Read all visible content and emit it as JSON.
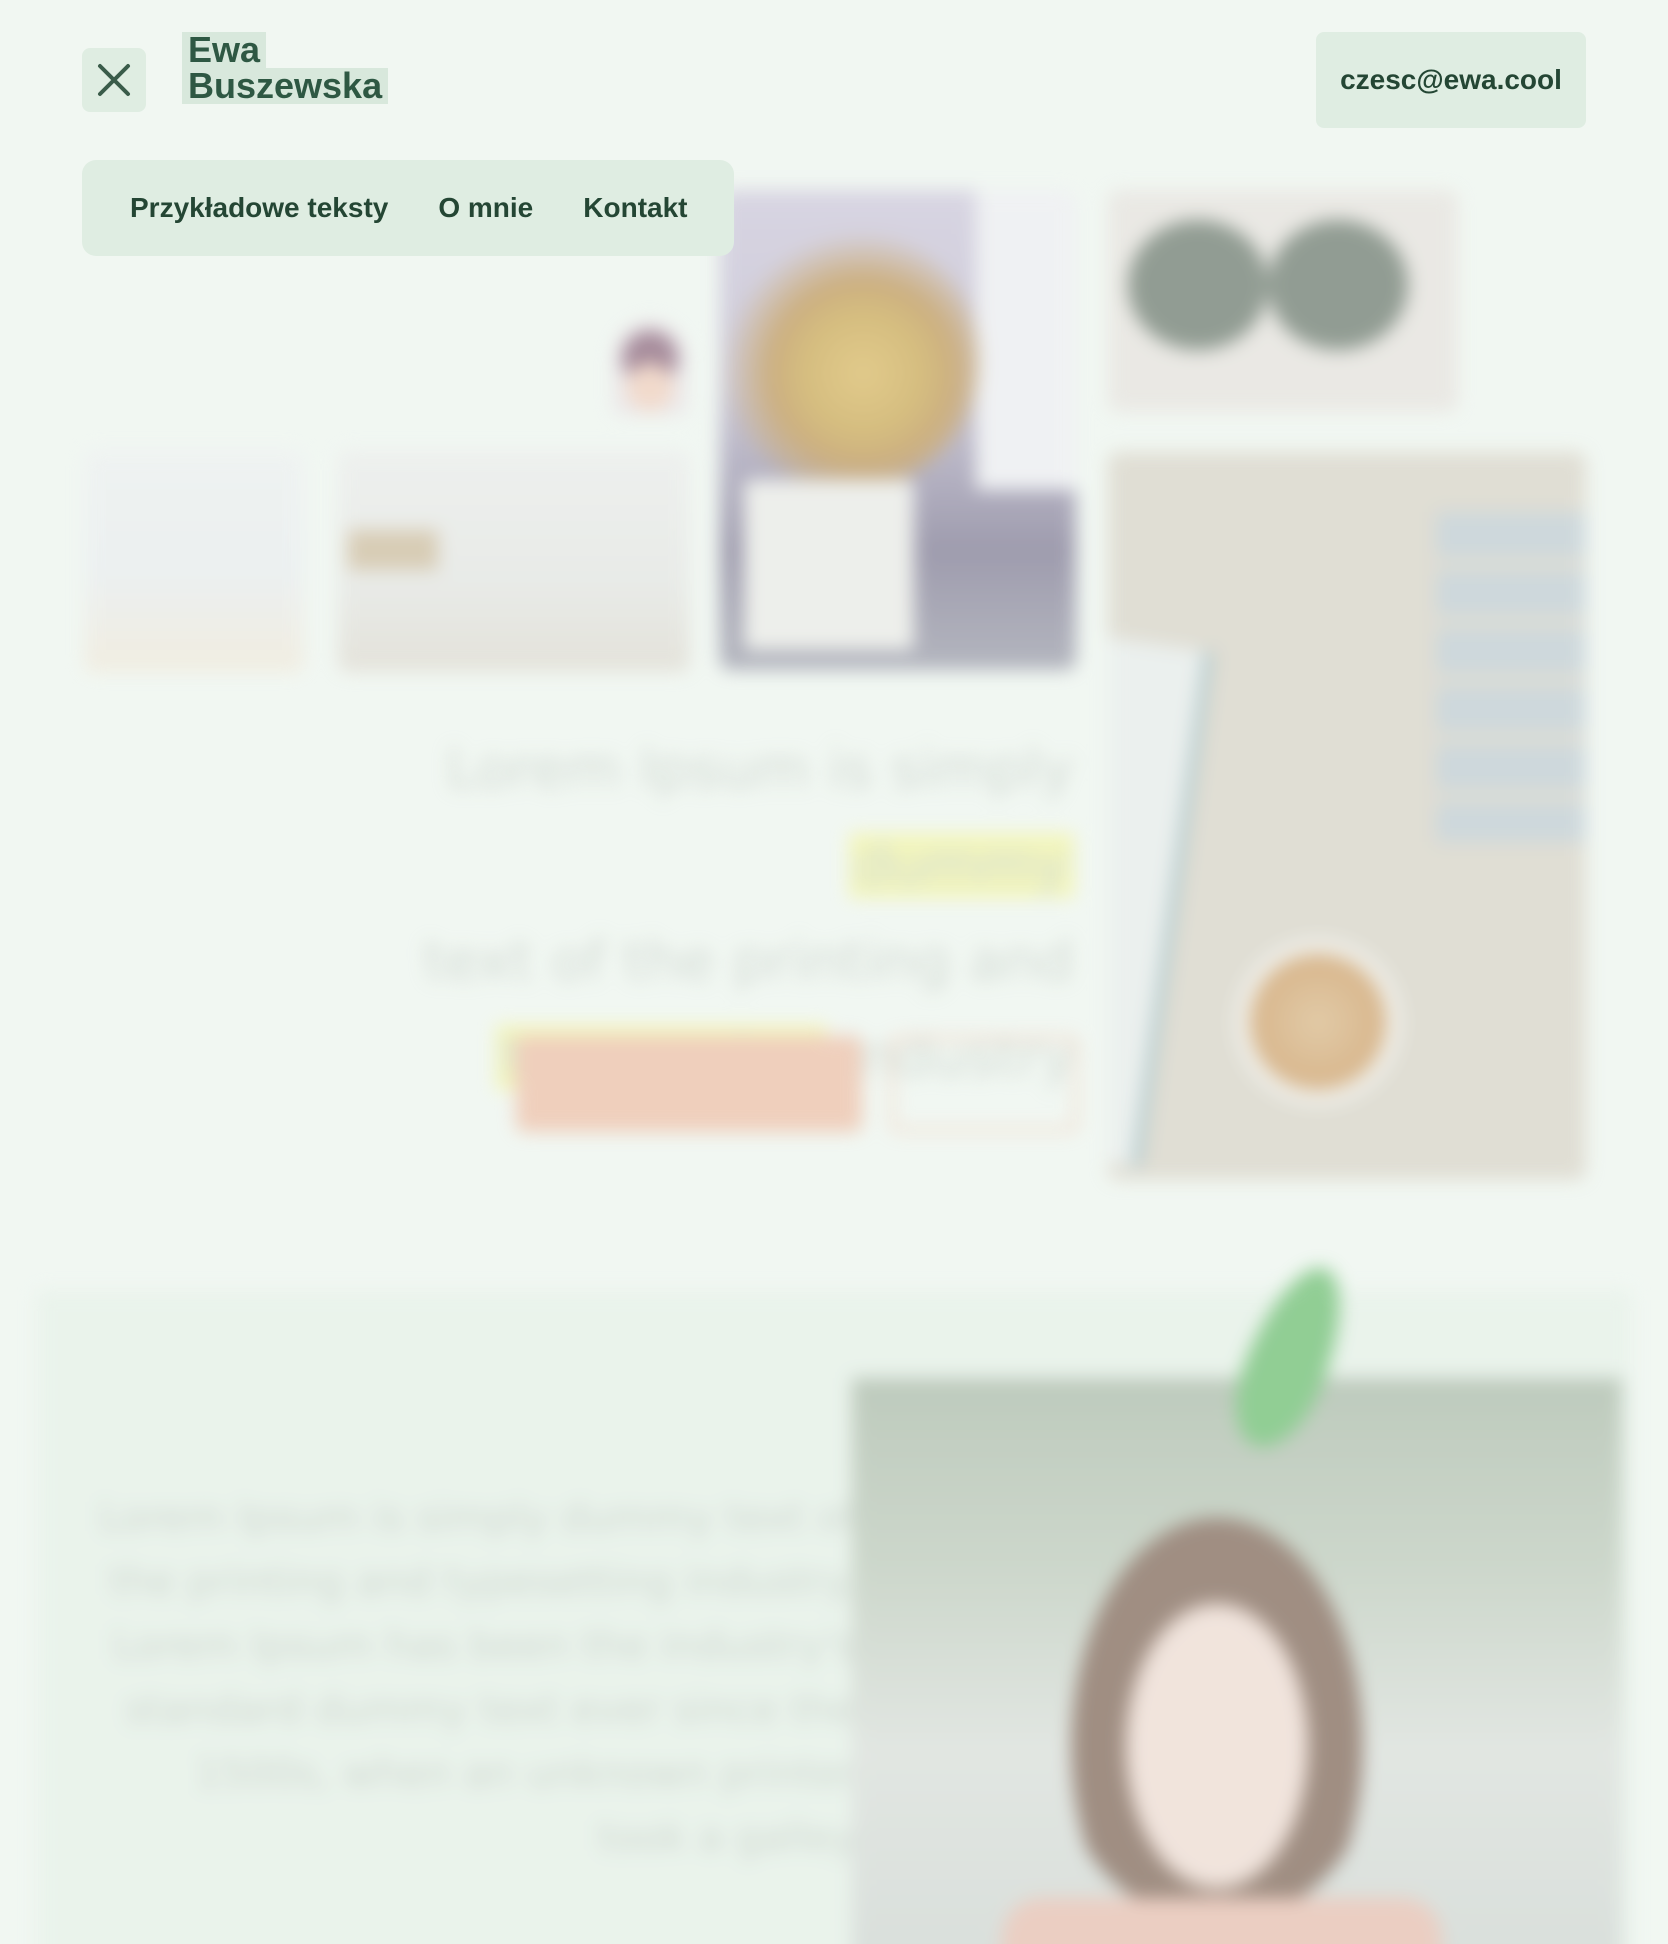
{
  "header": {
    "logo_line1": "Ewa",
    "logo_line2": "Buszewska",
    "email": "czesc@ewa.cool",
    "close_icon": "close-icon"
  },
  "nav": {
    "items": [
      {
        "label": "Przykładowe teksty"
      },
      {
        "label": "O mnie"
      },
      {
        "label": "Kontakt"
      }
    ]
  },
  "hero": {
    "headline_part1": "Lorem Ipsum is simply ",
    "headline_highlight1": "dummy",
    "headline_part2": "text of the printing and",
    "headline_highlight2": "typesetting",
    "headline_part3": " industry"
  },
  "about": {
    "text": "Lorem Ipsum is simply dummy text of the printing and typesetting industry. Lorem Ipsum has been the industry's standard dummy text ever since the 1500s, when an unknown printer took a galley"
  },
  "colors": {
    "background": "#f1f7f2",
    "chip": "#dfede2",
    "text_dark": "#244634",
    "accent_orange": "#eeb79c",
    "highlight_yellow": "#f4f59a"
  }
}
